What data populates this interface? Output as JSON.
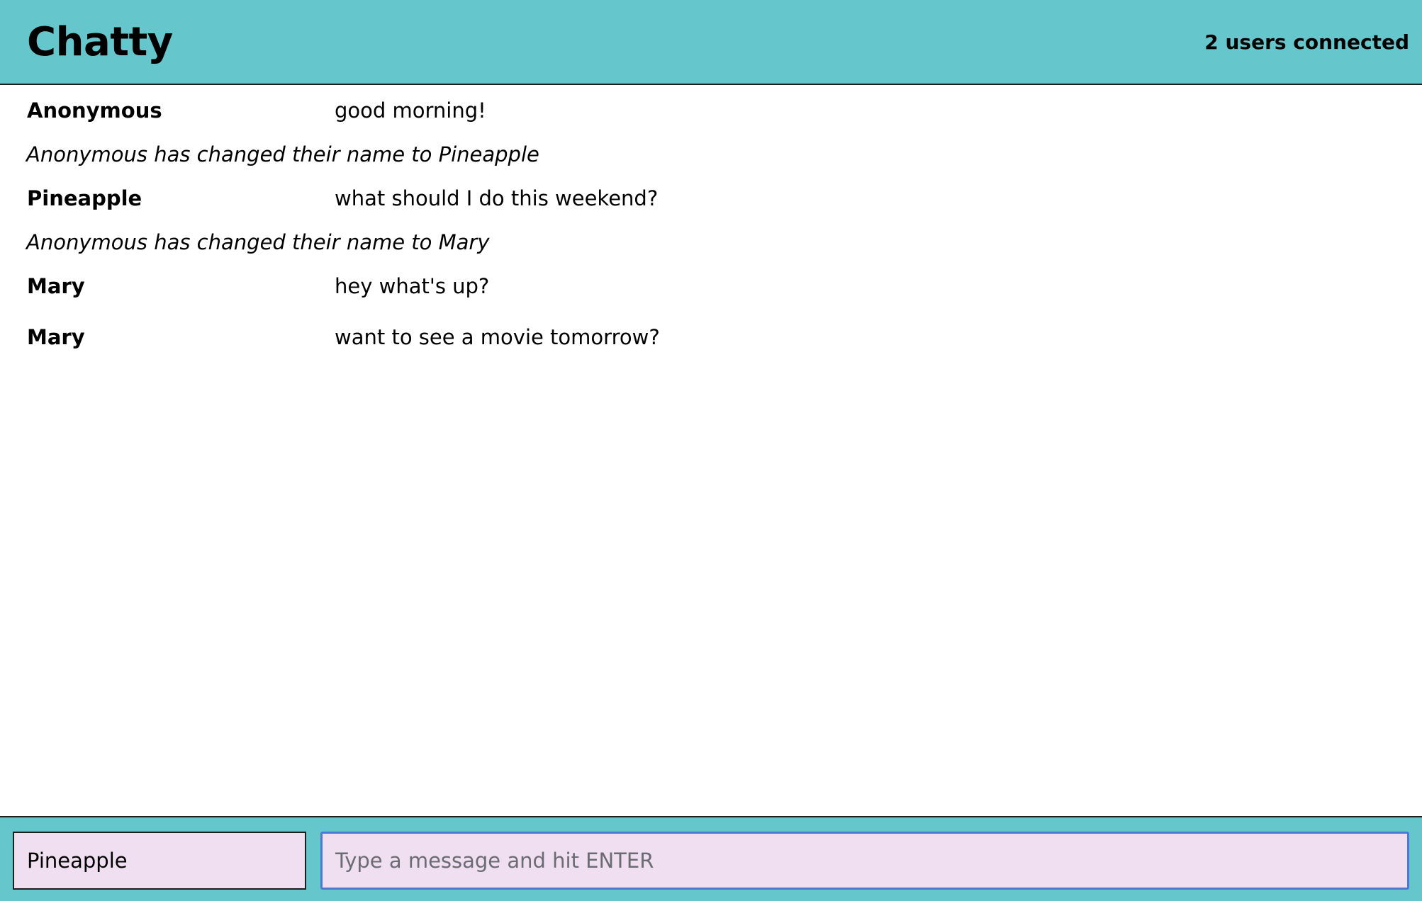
{
  "navbar": {
    "brand": "Chatty",
    "user_count": "2 users connected"
  },
  "messages": [
    {
      "type": "message",
      "username": "Anonymous",
      "content": "good morning!"
    },
    {
      "type": "system",
      "content": "Anonymous has changed their name to Pineapple"
    },
    {
      "type": "message",
      "username": "Pineapple",
      "content": "what should I do this weekend?"
    },
    {
      "type": "system",
      "content": "Anonymous has changed their name to Mary"
    },
    {
      "type": "message",
      "username": "Mary",
      "content": "hey what's up?"
    },
    {
      "type": "message",
      "username": "Mary",
      "content": "want to see a movie tomorrow?"
    }
  ],
  "chatbar": {
    "username_value": "Pineapple",
    "message_placeholder": "Type a message and hit ENTER",
    "message_value": ""
  },
  "colors": {
    "bar_background": "#65c6cb",
    "input_background": "#f0dff0",
    "focus_border": "#4a7ad8"
  }
}
